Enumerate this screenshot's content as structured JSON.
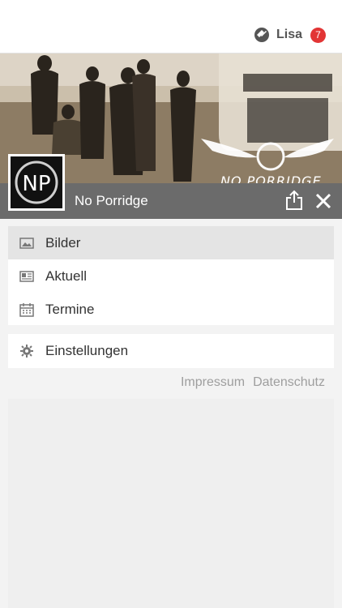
{
  "header": {
    "user_name": "Lisa",
    "notification_count": "7",
    "app_icon": "puzzle-logo-icon"
  },
  "hero": {
    "band_title": "NO PORRIDGE",
    "band_logo_text": "NP"
  },
  "profile": {
    "avatar_text": "NP",
    "name": "No Porridge",
    "share_icon": "share-icon",
    "close_icon": "close-icon"
  },
  "menu": {
    "items": [
      {
        "label": "Bilder",
        "icon": "image-icon"
      },
      {
        "label": "Aktuell",
        "icon": "newspaper-icon"
      },
      {
        "label": "Termine",
        "icon": "calendar-icon"
      }
    ],
    "settings": {
      "label": "Einstellungen",
      "icon": "gear-icon"
    }
  },
  "footer": {
    "impressum": "Impressum",
    "datenschutz": "Datenschutz"
  },
  "colors": {
    "badge": "#e23535",
    "profile_bar": "#6b6b6b",
    "active_item": "#e4e4e4",
    "link": "#9e9e9e"
  }
}
